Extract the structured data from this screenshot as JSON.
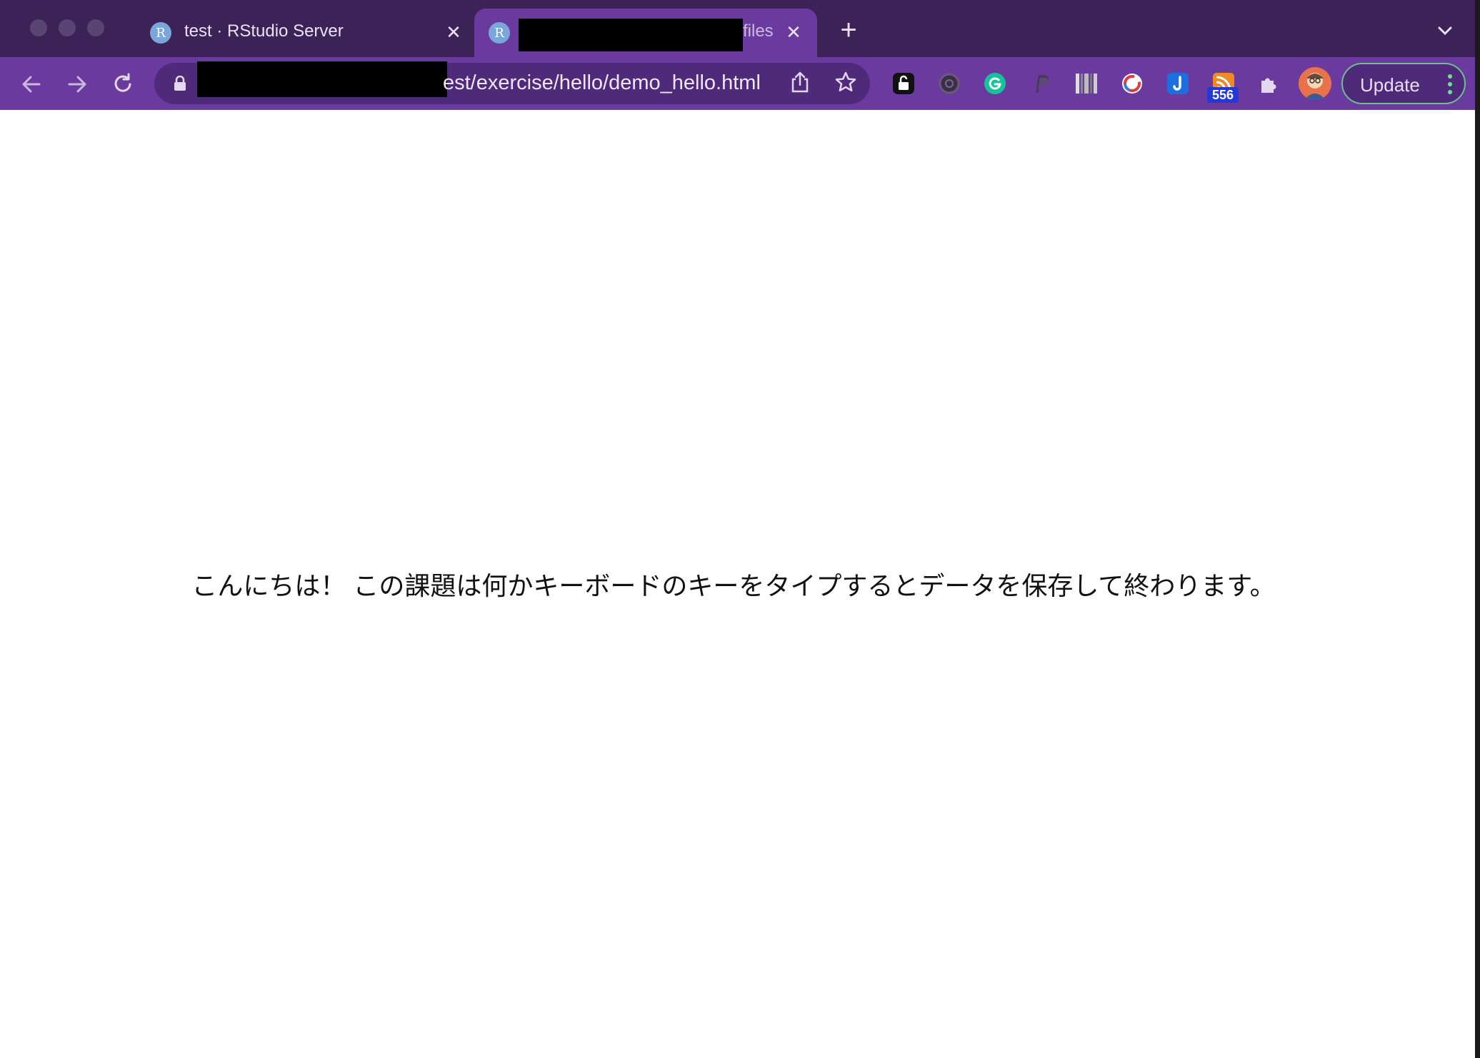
{
  "browser": {
    "tabs": [
      {
        "title": "test · RStudio Server",
        "favicon": "R",
        "active": false
      },
      {
        "title": "files",
        "favicon": "R",
        "active": true
      }
    ],
    "new_tab_label": "+",
    "close_label": "✕"
  },
  "toolbar": {
    "url_visible": "est/exercise/hello/demo_hello.html",
    "extension_badge": "556",
    "update_label": "Update"
  },
  "page": {
    "message": "こんにちは！ この課題は何かキーボードのキーをタイプするとデータを保存して終わります。"
  },
  "colors": {
    "tabstrip": "#3b2358",
    "toolbar": "#6a3a9e",
    "accent_green": "#6fbf8e"
  },
  "icons": [
    "back-icon",
    "forward-icon",
    "reload-icon",
    "lock-icon",
    "share-icon",
    "star-icon",
    "puzzle-icon",
    "kebab-menu-icon",
    "chevron-down-icon"
  ]
}
